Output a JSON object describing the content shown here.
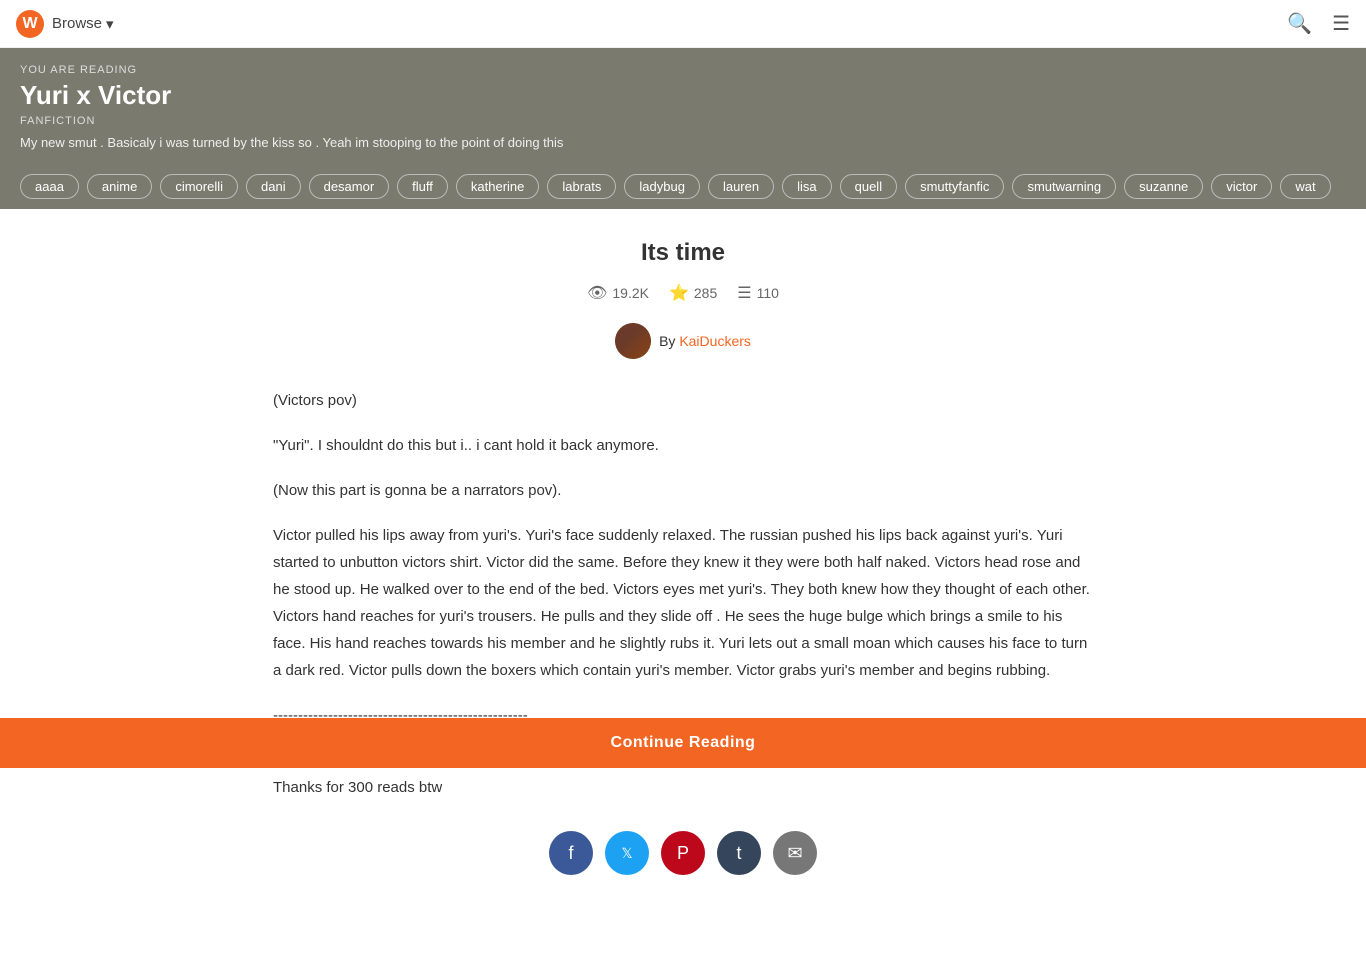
{
  "nav": {
    "logo_letter": "W",
    "browse_label": "Browse",
    "chevron": "▾"
  },
  "story_header": {
    "you_are_reading": "YOU ARE READING",
    "title": "Yuri x Victor",
    "genre": "FANFICTION",
    "description": "My new smut . Basicaly i was turned by the kiss so . Yeah im stooping to the point of doing this"
  },
  "tags": [
    "aaaa",
    "anime",
    "cimorelli",
    "dani",
    "desamor",
    "fluff",
    "katherine",
    "labrats",
    "ladybug",
    "lauren",
    "lisa",
    "quell",
    "smuttyfanfic",
    "smutwarning",
    "suzanne",
    "victor",
    "wat"
  ],
  "chapter": {
    "title": "Its time",
    "stats": {
      "views": "19.2K",
      "votes": "285",
      "parts": "110"
    },
    "author_prefix": "By",
    "author_name": "KaiDuckers",
    "body": [
      "(Victors pov)",
      "\"Yuri\". I shouldnt do this but i.. i cant hold it back anymore.",
      "(Now this part is gonna be a narrators pov).",
      "Victor pulled his lips away from yuri's. Yuri's face suddenly relaxed. The russian pushed his lips back against yuri's. Yuri started to unbutton victors shirt. Victor did the same. Before they knew it they were both half naked. Victors head rose and he stood up. He walked over to the end of the bed. Victors eyes met yuri's. They both knew how they thought of each other. Victors hand reaches for yuri's trousers. He pulls and they slide off . He sees the huge bulge which brings a smile to his face. His hand reaches towards his member and he slightly rubs it. Yuri lets out a small moan which causes his face to turn a dark red. Victor pulls down the boxers which contain yuri's member. Victor grabs yuri's member and begins rubbing.",
      "---------------------------------------------------",
      "Listen guys this is all im writing for now . Im tired and believe this isnt my best work\nThanks for 300 reads btw"
    ]
  },
  "share": {
    "facebook_label": "f",
    "twitter_label": "t",
    "pinterest_label": "P",
    "tumblr_label": "t",
    "email_label": "✉"
  },
  "continue_btn_label": "Continue Reading"
}
